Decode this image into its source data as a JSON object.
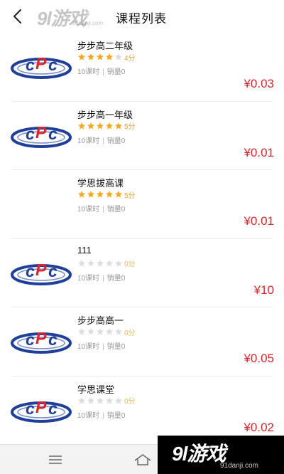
{
  "header": {
    "title": "课程列表",
    "back_icon": "chevron-left-icon"
  },
  "watermark_top": {
    "text": "9l游戏",
    "sub": "91danji.com"
  },
  "watermark_bottom": {
    "text": "9l游戏",
    "sub": "91danji.com"
  },
  "courses": [
    {
      "title": "步步高二年级",
      "rating": 4,
      "score_label": "4分",
      "lessons": "10课时",
      "sales": "销量0",
      "price": "¥0.03",
      "has_logo": true
    },
    {
      "title": "步步高一年级",
      "rating": 5,
      "score_label": "5分",
      "lessons": "10课时",
      "sales": "销量0",
      "price": "¥0.01",
      "has_logo": true
    },
    {
      "title": "学思拔高课",
      "rating": 5,
      "score_label": "5分",
      "lessons": "10课时",
      "sales": "销量0",
      "price": "¥0.01",
      "has_logo": false
    },
    {
      "title": "111",
      "rating": 0,
      "score_label": "0分",
      "lessons": "10课时",
      "sales": "销量0",
      "price": "¥10",
      "has_logo": true
    },
    {
      "title": "步步高高一",
      "rating": 0,
      "score_label": "0分",
      "lessons": "10课时",
      "sales": "销量0",
      "price": "¥0.05",
      "has_logo": true
    },
    {
      "title": "学思课堂",
      "rating": 0,
      "score_label": "0分",
      "lessons": "10课时",
      "sales": "销量0",
      "price": "¥0.02",
      "has_logo": true
    }
  ],
  "colors": {
    "price": "#d9262d",
    "star_filled": "#f5a623",
    "star_empty": "#dddddd",
    "logo_blue": "#1f3f98",
    "logo_red": "#d9262d"
  },
  "navbar": {
    "menu_icon": "menu-icon",
    "home_icon": "home-icon"
  }
}
